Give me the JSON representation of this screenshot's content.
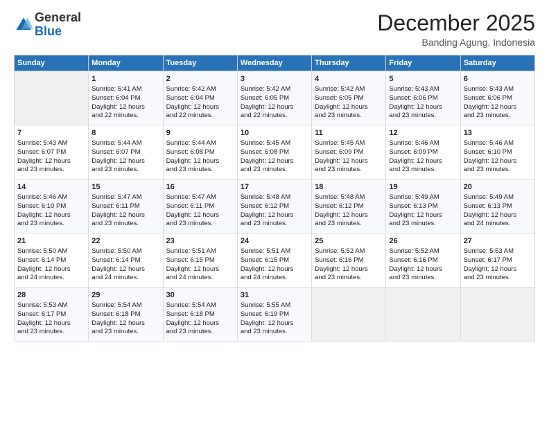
{
  "header": {
    "logo_general": "General",
    "logo_blue": "Blue",
    "month_title": "December 2025",
    "location": "Banding Agung, Indonesia"
  },
  "weekdays": [
    "Sunday",
    "Monday",
    "Tuesday",
    "Wednesday",
    "Thursday",
    "Friday",
    "Saturday"
  ],
  "weeks": [
    [
      {
        "day": "",
        "info": ""
      },
      {
        "day": "1",
        "info": "Sunrise: 5:41 AM\nSunset: 6:04 PM\nDaylight: 12 hours\nand 22 minutes."
      },
      {
        "day": "2",
        "info": "Sunrise: 5:42 AM\nSunset: 6:04 PM\nDaylight: 12 hours\nand 22 minutes."
      },
      {
        "day": "3",
        "info": "Sunrise: 5:42 AM\nSunset: 6:05 PM\nDaylight: 12 hours\nand 22 minutes."
      },
      {
        "day": "4",
        "info": "Sunrise: 5:42 AM\nSunset: 6:05 PM\nDaylight: 12 hours\nand 23 minutes."
      },
      {
        "day": "5",
        "info": "Sunrise: 5:43 AM\nSunset: 6:06 PM\nDaylight: 12 hours\nand 23 minutes."
      },
      {
        "day": "6",
        "info": "Sunrise: 5:43 AM\nSunset: 6:06 PM\nDaylight: 12 hours\nand 23 minutes."
      }
    ],
    [
      {
        "day": "7",
        "info": "Sunrise: 5:43 AM\nSunset: 6:07 PM\nDaylight: 12 hours\nand 23 minutes."
      },
      {
        "day": "8",
        "info": "Sunrise: 5:44 AM\nSunset: 6:07 PM\nDaylight: 12 hours\nand 23 minutes."
      },
      {
        "day": "9",
        "info": "Sunrise: 5:44 AM\nSunset: 6:08 PM\nDaylight: 12 hours\nand 23 minutes."
      },
      {
        "day": "10",
        "info": "Sunrise: 5:45 AM\nSunset: 6:08 PM\nDaylight: 12 hours\nand 23 minutes."
      },
      {
        "day": "11",
        "info": "Sunrise: 5:45 AM\nSunset: 6:09 PM\nDaylight: 12 hours\nand 23 minutes."
      },
      {
        "day": "12",
        "info": "Sunrise: 5:46 AM\nSunset: 6:09 PM\nDaylight: 12 hours\nand 23 minutes."
      },
      {
        "day": "13",
        "info": "Sunrise: 5:46 AM\nSunset: 6:10 PM\nDaylight: 12 hours\nand 23 minutes."
      }
    ],
    [
      {
        "day": "14",
        "info": "Sunrise: 5:46 AM\nSunset: 6:10 PM\nDaylight: 12 hours\nand 23 minutes."
      },
      {
        "day": "15",
        "info": "Sunrise: 5:47 AM\nSunset: 6:11 PM\nDaylight: 12 hours\nand 23 minutes."
      },
      {
        "day": "16",
        "info": "Sunrise: 5:47 AM\nSunset: 6:11 PM\nDaylight: 12 hours\nand 23 minutes."
      },
      {
        "day": "17",
        "info": "Sunrise: 5:48 AM\nSunset: 6:12 PM\nDaylight: 12 hours\nand 23 minutes."
      },
      {
        "day": "18",
        "info": "Sunrise: 5:48 AM\nSunset: 6:12 PM\nDaylight: 12 hours\nand 23 minutes."
      },
      {
        "day": "19",
        "info": "Sunrise: 5:49 AM\nSunset: 6:13 PM\nDaylight: 12 hours\nand 23 minutes."
      },
      {
        "day": "20",
        "info": "Sunrise: 5:49 AM\nSunset: 6:13 PM\nDaylight: 12 hours\nand 24 minutes."
      }
    ],
    [
      {
        "day": "21",
        "info": "Sunrise: 5:50 AM\nSunset: 6:14 PM\nDaylight: 12 hours\nand 24 minutes."
      },
      {
        "day": "22",
        "info": "Sunrise: 5:50 AM\nSunset: 6:14 PM\nDaylight: 12 hours\nand 24 minutes."
      },
      {
        "day": "23",
        "info": "Sunrise: 5:51 AM\nSunset: 6:15 PM\nDaylight: 12 hours\nand 24 minutes."
      },
      {
        "day": "24",
        "info": "Sunrise: 5:51 AM\nSunset: 6:15 PM\nDaylight: 12 hours\nand 24 minutes."
      },
      {
        "day": "25",
        "info": "Sunrise: 5:52 AM\nSunset: 6:16 PM\nDaylight: 12 hours\nand 23 minutes."
      },
      {
        "day": "26",
        "info": "Sunrise: 5:52 AM\nSunset: 6:16 PM\nDaylight: 12 hours\nand 23 minutes."
      },
      {
        "day": "27",
        "info": "Sunrise: 5:53 AM\nSunset: 6:17 PM\nDaylight: 12 hours\nand 23 minutes."
      }
    ],
    [
      {
        "day": "28",
        "info": "Sunrise: 5:53 AM\nSunset: 6:17 PM\nDaylight: 12 hours\nand 23 minutes."
      },
      {
        "day": "29",
        "info": "Sunrise: 5:54 AM\nSunset: 6:18 PM\nDaylight: 12 hours\nand 23 minutes."
      },
      {
        "day": "30",
        "info": "Sunrise: 5:54 AM\nSunset: 6:18 PM\nDaylight: 12 hours\nand 23 minutes."
      },
      {
        "day": "31",
        "info": "Sunrise: 5:55 AM\nSunset: 6:19 PM\nDaylight: 12 hours\nand 23 minutes."
      },
      {
        "day": "",
        "info": ""
      },
      {
        "day": "",
        "info": ""
      },
      {
        "day": "",
        "info": ""
      }
    ]
  ]
}
